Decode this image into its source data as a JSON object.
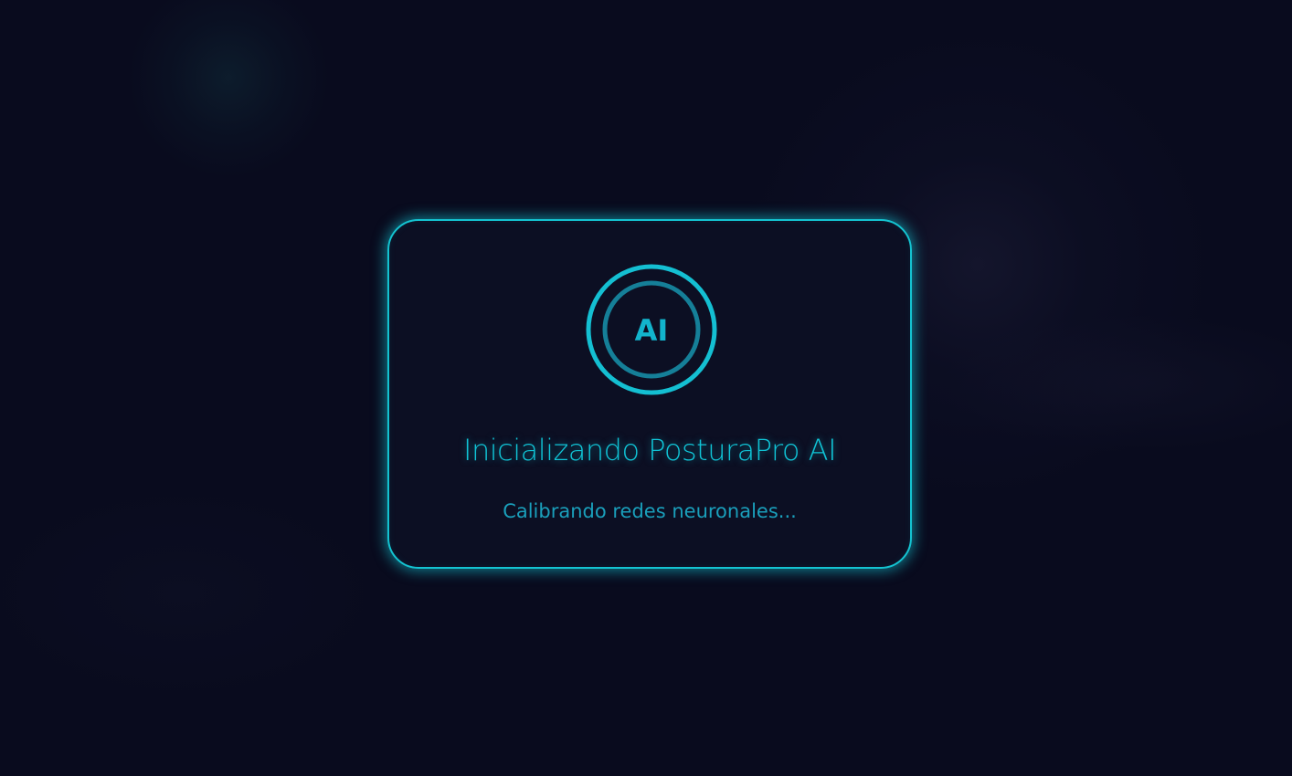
{
  "loader": {
    "badge_text": "AI",
    "title": "Inicializando PosturaPro AI",
    "status": "Calibrando redes neuronales..."
  },
  "colors": {
    "background": "#090b1e",
    "card": "#0c0f23",
    "accent": "#14c3d1",
    "accent_dim": "#1a8aa3",
    "status_text": "#1a9fbb"
  },
  "icons": {
    "logo": "ai-ring-icon"
  }
}
